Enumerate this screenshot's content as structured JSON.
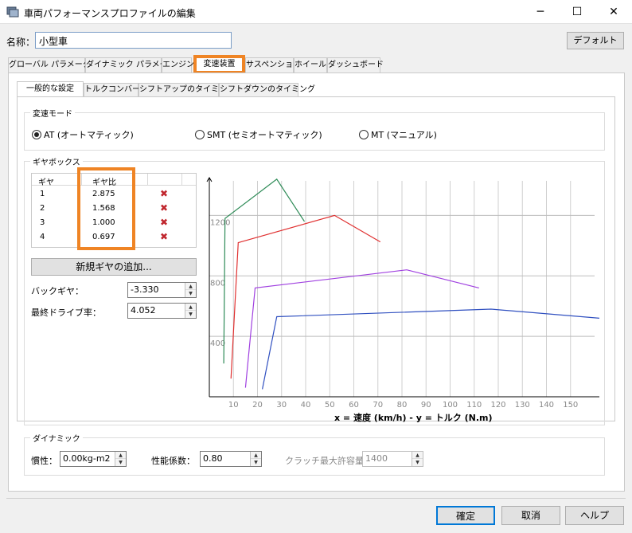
{
  "window": {
    "title": "車両パフォーマンスプロファイルの編集",
    "minimize": "─",
    "maximize": "☐",
    "close": "✕"
  },
  "name_field": {
    "label": "名称：",
    "value": "小型車"
  },
  "default_button": "デフォルト",
  "main_tabs": [
    {
      "label": "グローバル パラメータ"
    },
    {
      "label": "ダイナミック パラメータ"
    },
    {
      "label": "エンジン"
    },
    {
      "label": "変速装置"
    },
    {
      "label": "サスペンション"
    },
    {
      "label": "ホイール"
    },
    {
      "label": "ダッシュボード"
    }
  ],
  "sub_tabs": [
    {
      "label": "一般的な設定"
    },
    {
      "label": "トルクコンバータ"
    },
    {
      "label": "シフトアップのタイミング"
    },
    {
      "label": "シフトダウンのタイミング"
    }
  ],
  "transmission_mode": {
    "title": "変速モード",
    "options": [
      {
        "label": "AT (オートマティック)",
        "selected": true
      },
      {
        "label": "SMT (セミオートマティック)",
        "selected": false
      },
      {
        "label": "MT (マニュアル)",
        "selected": false
      }
    ]
  },
  "gearbox": {
    "title": "ギヤボックス",
    "headers": {
      "gear": "ギヤ",
      "ratio": "ギヤ比"
    },
    "rows": [
      {
        "gear": "1",
        "ratio": "2.875"
      },
      {
        "gear": "2",
        "ratio": "1.568"
      },
      {
        "gear": "3",
        "ratio": "1.000"
      },
      {
        "gear": "4",
        "ratio": "0.697"
      }
    ],
    "delete_icon": "x-mark-icon",
    "add_button": "新規ギヤの追加...",
    "reverse_label": "バックギヤ：",
    "reverse_value": "-3.330",
    "final_drive_label": "最終ドライブ率：",
    "final_drive_value": "4.052"
  },
  "dynamics": {
    "title": "ダイナミック",
    "inertia_label": "慣性：",
    "inertia_value": "0.00kg-m2",
    "perf_label": "性能係数：",
    "perf_value": "0.80",
    "clutch_label": "クラッチ最大許容量:",
    "clutch_value": "1400"
  },
  "buttons": {
    "ok": "確定",
    "cancel": "取消",
    "help": "ヘルプ"
  },
  "colors": {
    "highlight": "#ef8424",
    "gear1": "#2e8b57",
    "gear2": "#e03030",
    "gear3": "#a040e0",
    "gear4": "#3050c0"
  },
  "chart_data": {
    "type": "line",
    "xlabel": "x = 速度 (km/h) - y = トルク (N.m)",
    "x_ticks": [
      10,
      20,
      30,
      40,
      50,
      60,
      70,
      80,
      90,
      100,
      110,
      120,
      130,
      140,
      150
    ],
    "y_ticks": [
      400,
      800,
      1200
    ],
    "xlim": [
      0,
      160
    ],
    "ylim": [
      0,
      1450
    ],
    "grid": true,
    "series": [
      {
        "x": [
          6,
          6.5,
          28,
          39.5
        ],
        "y": [
          220,
          1180,
          1440,
          1160
        ]
      },
      {
        "x": [
          9,
          12,
          52,
          71
        ],
        "y": [
          120,
          1020,
          1200,
          1025
        ]
      },
      {
        "x": [
          15,
          19,
          82,
          112
        ],
        "y": [
          60,
          720,
          840,
          720
        ]
      },
      {
        "x": [
          22,
          28,
          117,
          162
        ],
        "y": [
          50,
          530,
          580,
          520
        ]
      }
    ]
  }
}
